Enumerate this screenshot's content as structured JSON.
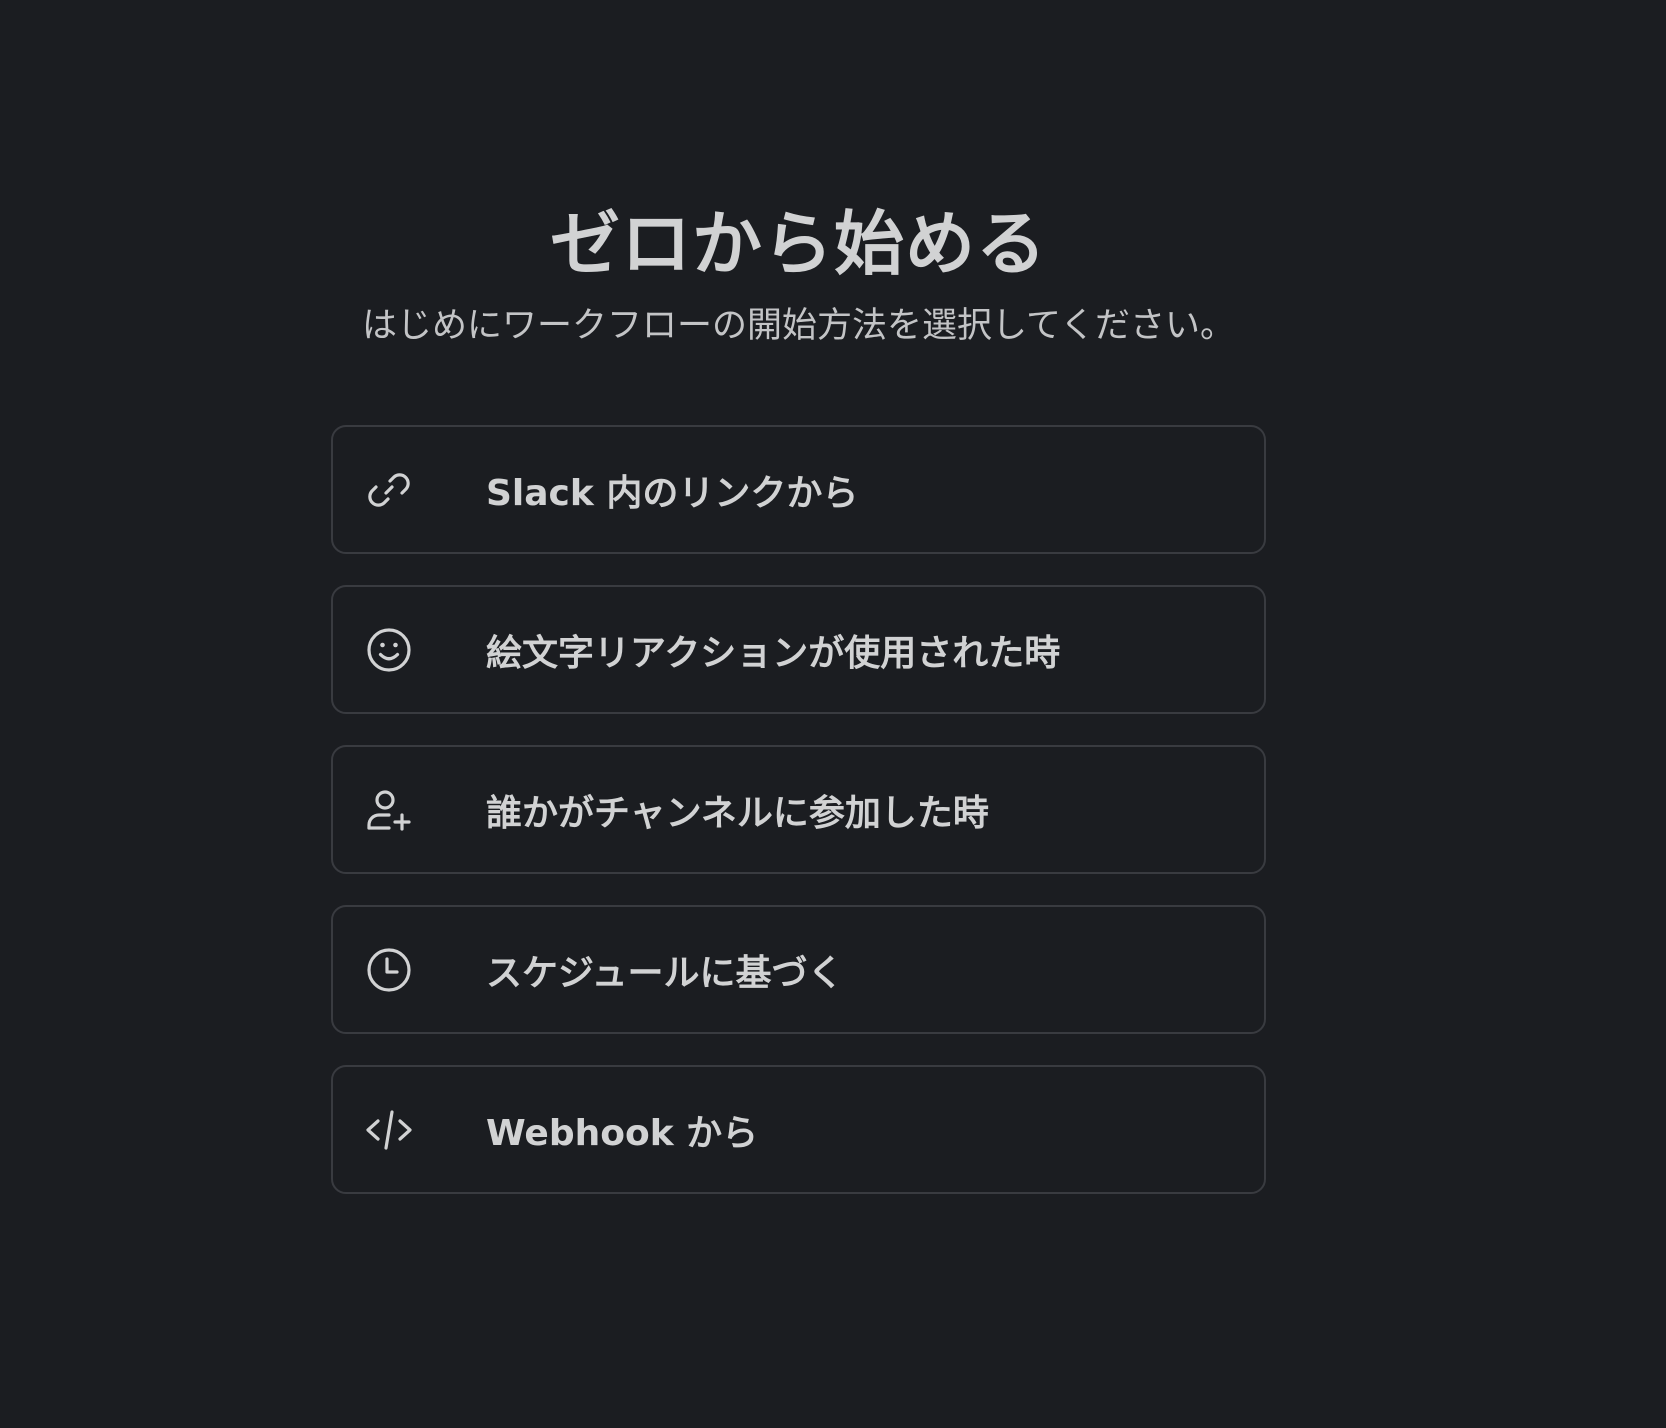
{
  "header": {
    "title": "ゼロから始める",
    "subtitle": "はじめにワークフローの開始方法を選択してください。"
  },
  "options": [
    {
      "icon": "link-icon",
      "label": "Slack 内のリンクから"
    },
    {
      "icon": "emoji-icon",
      "label": "絵文字リアクションが使用された時"
    },
    {
      "icon": "user-add-icon",
      "label": "誰かがチャンネルに参加した時"
    },
    {
      "icon": "clock-icon",
      "label": "スケジュールに基づく"
    },
    {
      "icon": "code-icon",
      "label": "Webhook から"
    }
  ],
  "colors": {
    "background": "#1b1d21",
    "text": "#d1d2d3",
    "border": "#393b40"
  }
}
